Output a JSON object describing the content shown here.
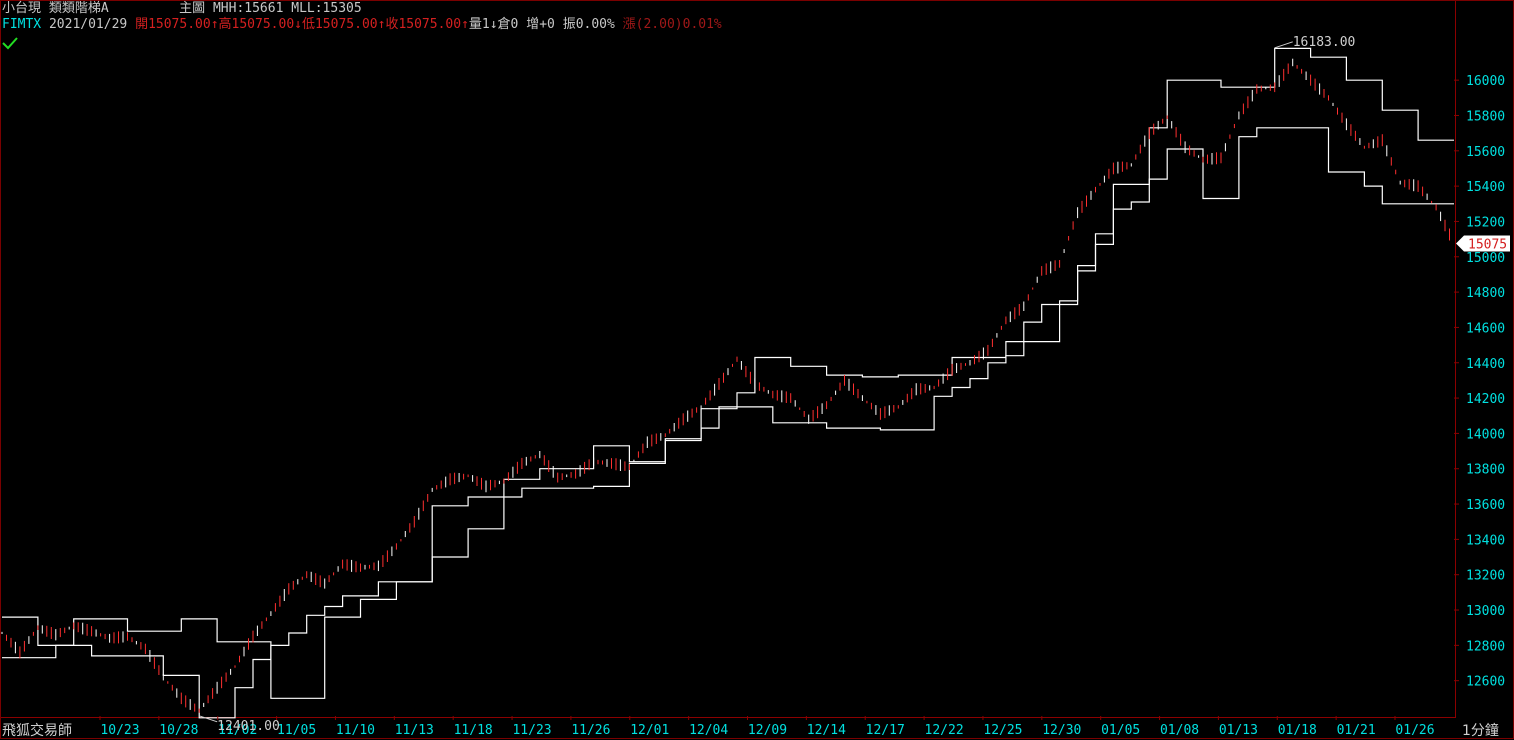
{
  "header": {
    "product": "小台現",
    "chart_style": "類類階梯A",
    "main_label": "主圖",
    "mhh": "MHH:15661",
    "mll": "MLL:15305",
    "symbol": "FIMTX",
    "date": "2021/01/29",
    "open": "開15075.00",
    "high": "高15075.00",
    "low": "低15075.00",
    "close": "收15075.00",
    "volume": "量1",
    "oi": "倉0",
    "oi_change": "增+0",
    "amplitude": "振0.00%",
    "change": "漲(2.00)0.01%"
  },
  "footer": {
    "brand": "飛狐交易師",
    "period": "1分鐘"
  },
  "colors": {
    "background": "#000000",
    "axis_text_y": "#00e0e0",
    "axis_text_x": "#00e0e0",
    "up_candle": "#ff3030",
    "down_candle": "#ffffff",
    "step_line": "#ffffff",
    "frame": "#8b0000",
    "last_price_bg": "#ffffff",
    "last_price_text": "#d42020"
  },
  "chart_data": {
    "type": "line",
    "title": "",
    "xlabel": "",
    "ylabel": "",
    "ylim": [
      12400,
      16250
    ],
    "y_ticks": [
      12600,
      12800,
      13000,
      13200,
      13400,
      13600,
      13800,
      14000,
      14200,
      14400,
      14600,
      14800,
      15000,
      15200,
      15400,
      15600,
      15800,
      16000
    ],
    "categories": [
      "10/23",
      "10/28",
      "11/02",
      "11/05",
      "11/10",
      "11/13",
      "11/18",
      "11/23",
      "11/26",
      "12/01",
      "12/04",
      "12/09",
      "12/14",
      "12/17",
      "12/22",
      "12/25",
      "12/30",
      "01/05",
      "01/08",
      "01/13",
      "01/18",
      "01/21",
      "01/26"
    ],
    "annotations": [
      {
        "text": "16183.00",
        "value": 16183,
        "category": "01/21"
      },
      {
        "text": "12401.00",
        "value": 12401,
        "category": "11/02"
      }
    ],
    "last_price": {
      "text": "15075",
      "value": 15075
    },
    "series": [
      {
        "values": [
          12870,
          12760,
          12900,
          12860,
          12910,
          12880,
          12840,
          12850,
          12780,
          12620,
          12500,
          12430,
          12560,
          12680,
          12850,
          12980,
          13120,
          13200,
          13150,
          13260,
          13240,
          13250,
          13360,
          13500,
          13680,
          13740,
          13760,
          13700,
          13730,
          13830,
          13880,
          13750,
          13770,
          13840,
          13830,
          13810,
          13950,
          13990,
          14080,
          14150,
          14280,
          14420,
          14280,
          14220,
          14200,
          14080,
          14160,
          14300,
          14200,
          14110,
          14150,
          14250,
          14260,
          14360,
          14400,
          14470,
          14640,
          14720,
          14920,
          14960,
          15250,
          15380,
          15500,
          15520,
          15700,
          15790,
          15620,
          15550,
          15560,
          15800,
          15950,
          15960,
          16100,
          16000,
          15900,
          15750,
          15620,
          15660,
          15420,
          15400,
          15280,
          15075
        ]
      },
      {
        "values": [
          12960,
          12960,
          12800,
          12800,
          12950,
          12950,
          12950,
          12880,
          12880,
          12880,
          12950,
          12950,
          12820,
          12820,
          12820,
          12500,
          12500,
          12500,
          12960,
          12960,
          13060,
          13060,
          13160,
          13160,
          13300,
          13300,
          13460,
          13460,
          13740,
          13740,
          13800,
          13800,
          13800,
          13930,
          13930,
          13840,
          13840,
          13970,
          13970,
          14140,
          14140,
          14230,
          14430,
          14430,
          14380,
          14380,
          14330,
          14330,
          14320,
          14320,
          14330,
          14330,
          14330,
          14430,
          14430,
          14430,
          14440,
          14630,
          14730,
          14730,
          14950,
          15130,
          15410,
          15410,
          15730,
          16000,
          16000,
          16000,
          15960,
          15960,
          15960,
          16180,
          16180,
          16130,
          16130,
          16000,
          16000,
          15830,
          15830,
          15660,
          15660,
          15660
        ]
      },
      {
        "values": [
          12730,
          12730,
          12730,
          12800,
          12800,
          12740,
          12740,
          12740,
          12740,
          12630,
          12630,
          12390,
          12390,
          12560,
          12720,
          12800,
          12870,
          12970,
          13020,
          13080,
          13080,
          13160,
          13160,
          13160,
          13590,
          13590,
          13640,
          13640,
          13640,
          13690,
          13690,
          13690,
          13690,
          13700,
          13700,
          13830,
          13830,
          13960,
          13960,
          14030,
          14150,
          14150,
          14150,
          14060,
          14060,
          14060,
          14030,
          14030,
          14030,
          14020,
          14020,
          14020,
          14210,
          14260,
          14310,
          14400,
          14520,
          14520,
          14520,
          14750,
          14920,
          15070,
          15270,
          15310,
          15440,
          15610,
          15610,
          15330,
          15330,
          15680,
          15730,
          15730,
          15730,
          15730,
          15480,
          15480,
          15400,
          15300,
          15300,
          15300,
          15300,
          15300
        ]
      }
    ]
  }
}
